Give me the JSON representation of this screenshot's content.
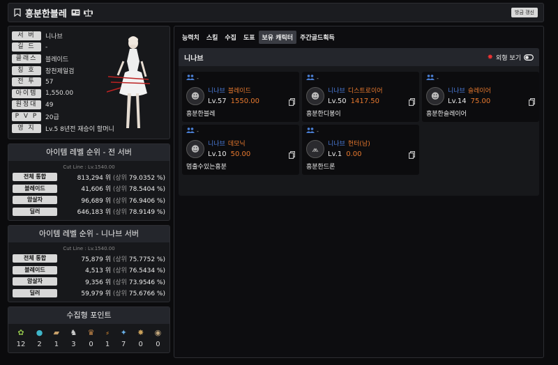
{
  "header": {
    "name": "흥분한블레",
    "refresh_label": "방금 갱신"
  },
  "profile": {
    "rows": [
      {
        "label": "서 버",
        "value": "니나브"
      },
      {
        "label": "길 드",
        "value": "-"
      },
      {
        "label": "클래스",
        "value": "블레이드"
      },
      {
        "label": "칭 호",
        "value": "창천제일검"
      },
      {
        "label": "전 투",
        "value": "57"
      },
      {
        "label": "아이템",
        "value": "1,550.00"
      },
      {
        "label": "원정대",
        "value": "49"
      },
      {
        "label": "P V P",
        "value": "20급"
      },
      {
        "label": "영 지",
        "value": "Lv.5 8년전 재승이 할머니"
      }
    ]
  },
  "rank_all": {
    "title": "아이템 레벨 순위 - 전 서버",
    "cutline": "Cut Line : Lv.1540.00",
    "rows": [
      {
        "label": "전체 통합",
        "num": "813,294 위",
        "open": "(상위",
        "pct": "79.0352 %)"
      },
      {
        "label": "블레이드",
        "num": "41,606 위",
        "open": "(상위",
        "pct": "78.5404 %)"
      },
      {
        "label": "암살자",
        "num": "96,689 위",
        "open": "(상위",
        "pct": "76.9406 %)"
      },
      {
        "label": "딜러",
        "num": "646,183 위",
        "open": "(상위",
        "pct": "78.9149 %)"
      }
    ]
  },
  "rank_server": {
    "title": "아이템 레벨 순위 - 니나브 서버",
    "cutline": "Cut Line : Lv.1540.00",
    "rows": [
      {
        "label": "전체 통합",
        "num": "75,879 위",
        "open": "(상위",
        "pct": "75.7752 %)"
      },
      {
        "label": "블레이드",
        "num": "4,513 위",
        "open": "(상위",
        "pct": "76.5434 %)"
      },
      {
        "label": "암살자",
        "num": "9,356 위",
        "open": "(상위",
        "pct": "73.9546 %)"
      },
      {
        "label": "딜러",
        "num": "59,979 위",
        "open": "(상위",
        "pct": "75.6766 %)"
      }
    ]
  },
  "collect": {
    "title": "수집형 포인트",
    "items": [
      {
        "icon": "seed-icon",
        "glyph": "✿",
        "color": "#8fbf4a",
        "count": "12"
      },
      {
        "icon": "island-heart-icon",
        "glyph": "●",
        "color": "#3fb6c9",
        "count": "2"
      },
      {
        "icon": "art-icon",
        "glyph": "▰",
        "color": "#c8a06a",
        "count": "1"
      },
      {
        "icon": "giant-heart-icon",
        "glyph": "♞",
        "color": "#cfcfcf",
        "count": "3"
      },
      {
        "icon": "ignea-icon",
        "glyph": "♛",
        "color": "#c98a4a",
        "count": "0"
      },
      {
        "icon": "orpheus-star-icon",
        "glyph": "⸗",
        "color": "#d0862e",
        "count": "1"
      },
      {
        "icon": "world-tree-leaf-icon",
        "glyph": "✦",
        "color": "#6ab0e8",
        "count": "7"
      },
      {
        "icon": "sea-bounty-icon",
        "glyph": "✸",
        "color": "#c9a05a",
        "count": "0"
      },
      {
        "icon": "sky-badge-icon",
        "glyph": "◉",
        "color": "#bfa47a",
        "count": "0"
      }
    ]
  },
  "tabs": [
    "능력치",
    "스킬",
    "수집",
    "도표",
    "보유 캐릭터",
    "주간골드획득"
  ],
  "active_tab": 4,
  "roster": {
    "server": "니나브",
    "view_label": "외형 보기",
    "chars": [
      {
        "server": "니나브",
        "class": "블레이드",
        "lv": "Lv.57",
        "ilvl": "1550.00",
        "name": "흥분한블레",
        "avatar_glyph": "☻"
      },
      {
        "server": "니나브",
        "class": "디스트로이어",
        "lv": "Lv.50",
        "ilvl": "1417.50",
        "name": "흥분한디봉이",
        "avatar_glyph": "☻"
      },
      {
        "server": "니나브",
        "class": "슬레이어",
        "lv": "Lv.14",
        "ilvl": "75.00",
        "name": "흥분한슬레이어",
        "avatar_glyph": "☻"
      },
      {
        "server": "니나브",
        "class": "데모닉",
        "lv": "Lv.10",
        "ilvl": "50.00",
        "name": "멈출수있는흥분",
        "avatar_glyph": "☻"
      },
      {
        "server": "니나브",
        "class": "헌터(남)",
        "lv": "Lv.1",
        "ilvl": "0.00",
        "name": "흥분한드론",
        "avatar_glyph": "⩕"
      }
    ]
  }
}
